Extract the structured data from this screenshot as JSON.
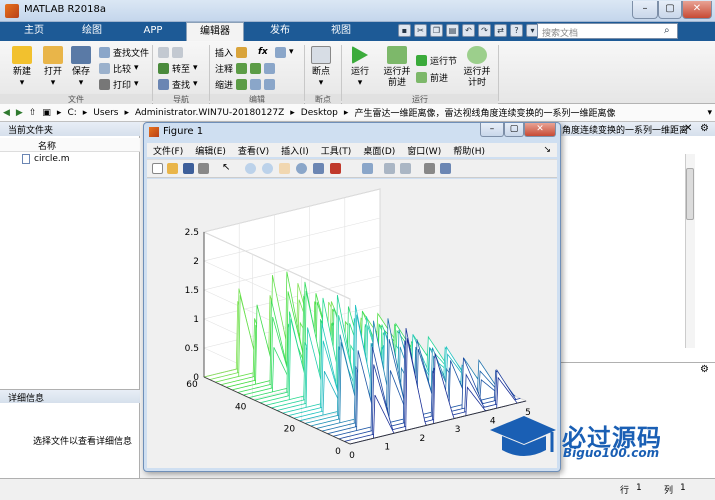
{
  "window": {
    "title": "MATLAB R2018a",
    "min": "–",
    "max": "▢",
    "close": "✕"
  },
  "tabs": [
    "主页",
    "绘图",
    "APP",
    "编辑器",
    "发布",
    "视图"
  ],
  "search": {
    "placeholder": "搜索文档"
  },
  "ribbon": {
    "file": {
      "new": "新建",
      "open": "打开",
      "save": "保存",
      "find_files": "查找文件",
      "compare": "比较",
      "print": "打印",
      "label": "文件"
    },
    "nav": {
      "goto": "转至",
      "find": "查找",
      "label": "导航"
    },
    "edit": {
      "insert": "插入",
      "comment": "注释",
      "indent": "缩进",
      "fx": "fx",
      "label": "编辑"
    },
    "breakpoints": {
      "breakpoint": "断点",
      "label": "断点"
    },
    "run": {
      "run": "运行",
      "run_advance_1": "运行并",
      "run_advance_2": "前进",
      "run_section": "运行节",
      "advance": "前进",
      "run_time_1": "运行并",
      "run_time_2": "计时",
      "label": "运行"
    }
  },
  "address": {
    "parts": [
      "C:",
      "Users",
      "Administrator.WIN7U-20180127Z",
      "Desktop",
      "产生雷达一维距离像，雷达视线角度连续变换的一系列一维距离像"
    ]
  },
  "current_folder": {
    "title": "当前文件夹",
    "col_name": "名称",
    "files": [
      "circle.m"
    ]
  },
  "details": {
    "title": "详细信息",
    "hint": "选择文件以查看详细信息"
  },
  "editor_header": "角度连续变换的一系列一维距离",
  "status": {
    "row_label": "行",
    "row": "1",
    "col_label": "列",
    "col": "1"
  },
  "figure": {
    "title": "Figure 1",
    "menus": [
      "文件(F)",
      "编辑(E)",
      "查看(V)",
      "插入(I)",
      "工具(T)",
      "桌面(D)",
      "窗口(W)",
      "帮助(H)"
    ]
  },
  "chart_data": {
    "type": "waterfall-3d",
    "title": "",
    "xlabel": "",
    "ylabel": "",
    "zlabel": "",
    "x_ticks": [
      "0",
      "1",
      "2",
      "3",
      "4",
      "5"
    ],
    "y_ticks": [
      "0",
      "20",
      "40",
      "60"
    ],
    "z_ticks": [
      "0",
      "0.5",
      "1",
      "1.5",
      "2",
      "2.5"
    ],
    "xlim": [
      0,
      5
    ],
    "ylim": [
      0,
      60
    ],
    "zlim": [
      0,
      2.5
    ],
    "grid": true,
    "peak_x": [
      0.7,
      1.6,
      2.4,
      3.3,
      4.2
    ],
    "peak_z": [
      1.5,
      1.8,
      1.3,
      0.9,
      0.6
    ]
  },
  "logo": {
    "text_cn": "必过源码",
    "text_en": "Biguo100.com"
  },
  "colors": {
    "tab_bar": "#1d5a96",
    "accent": "#1a5fb4"
  }
}
